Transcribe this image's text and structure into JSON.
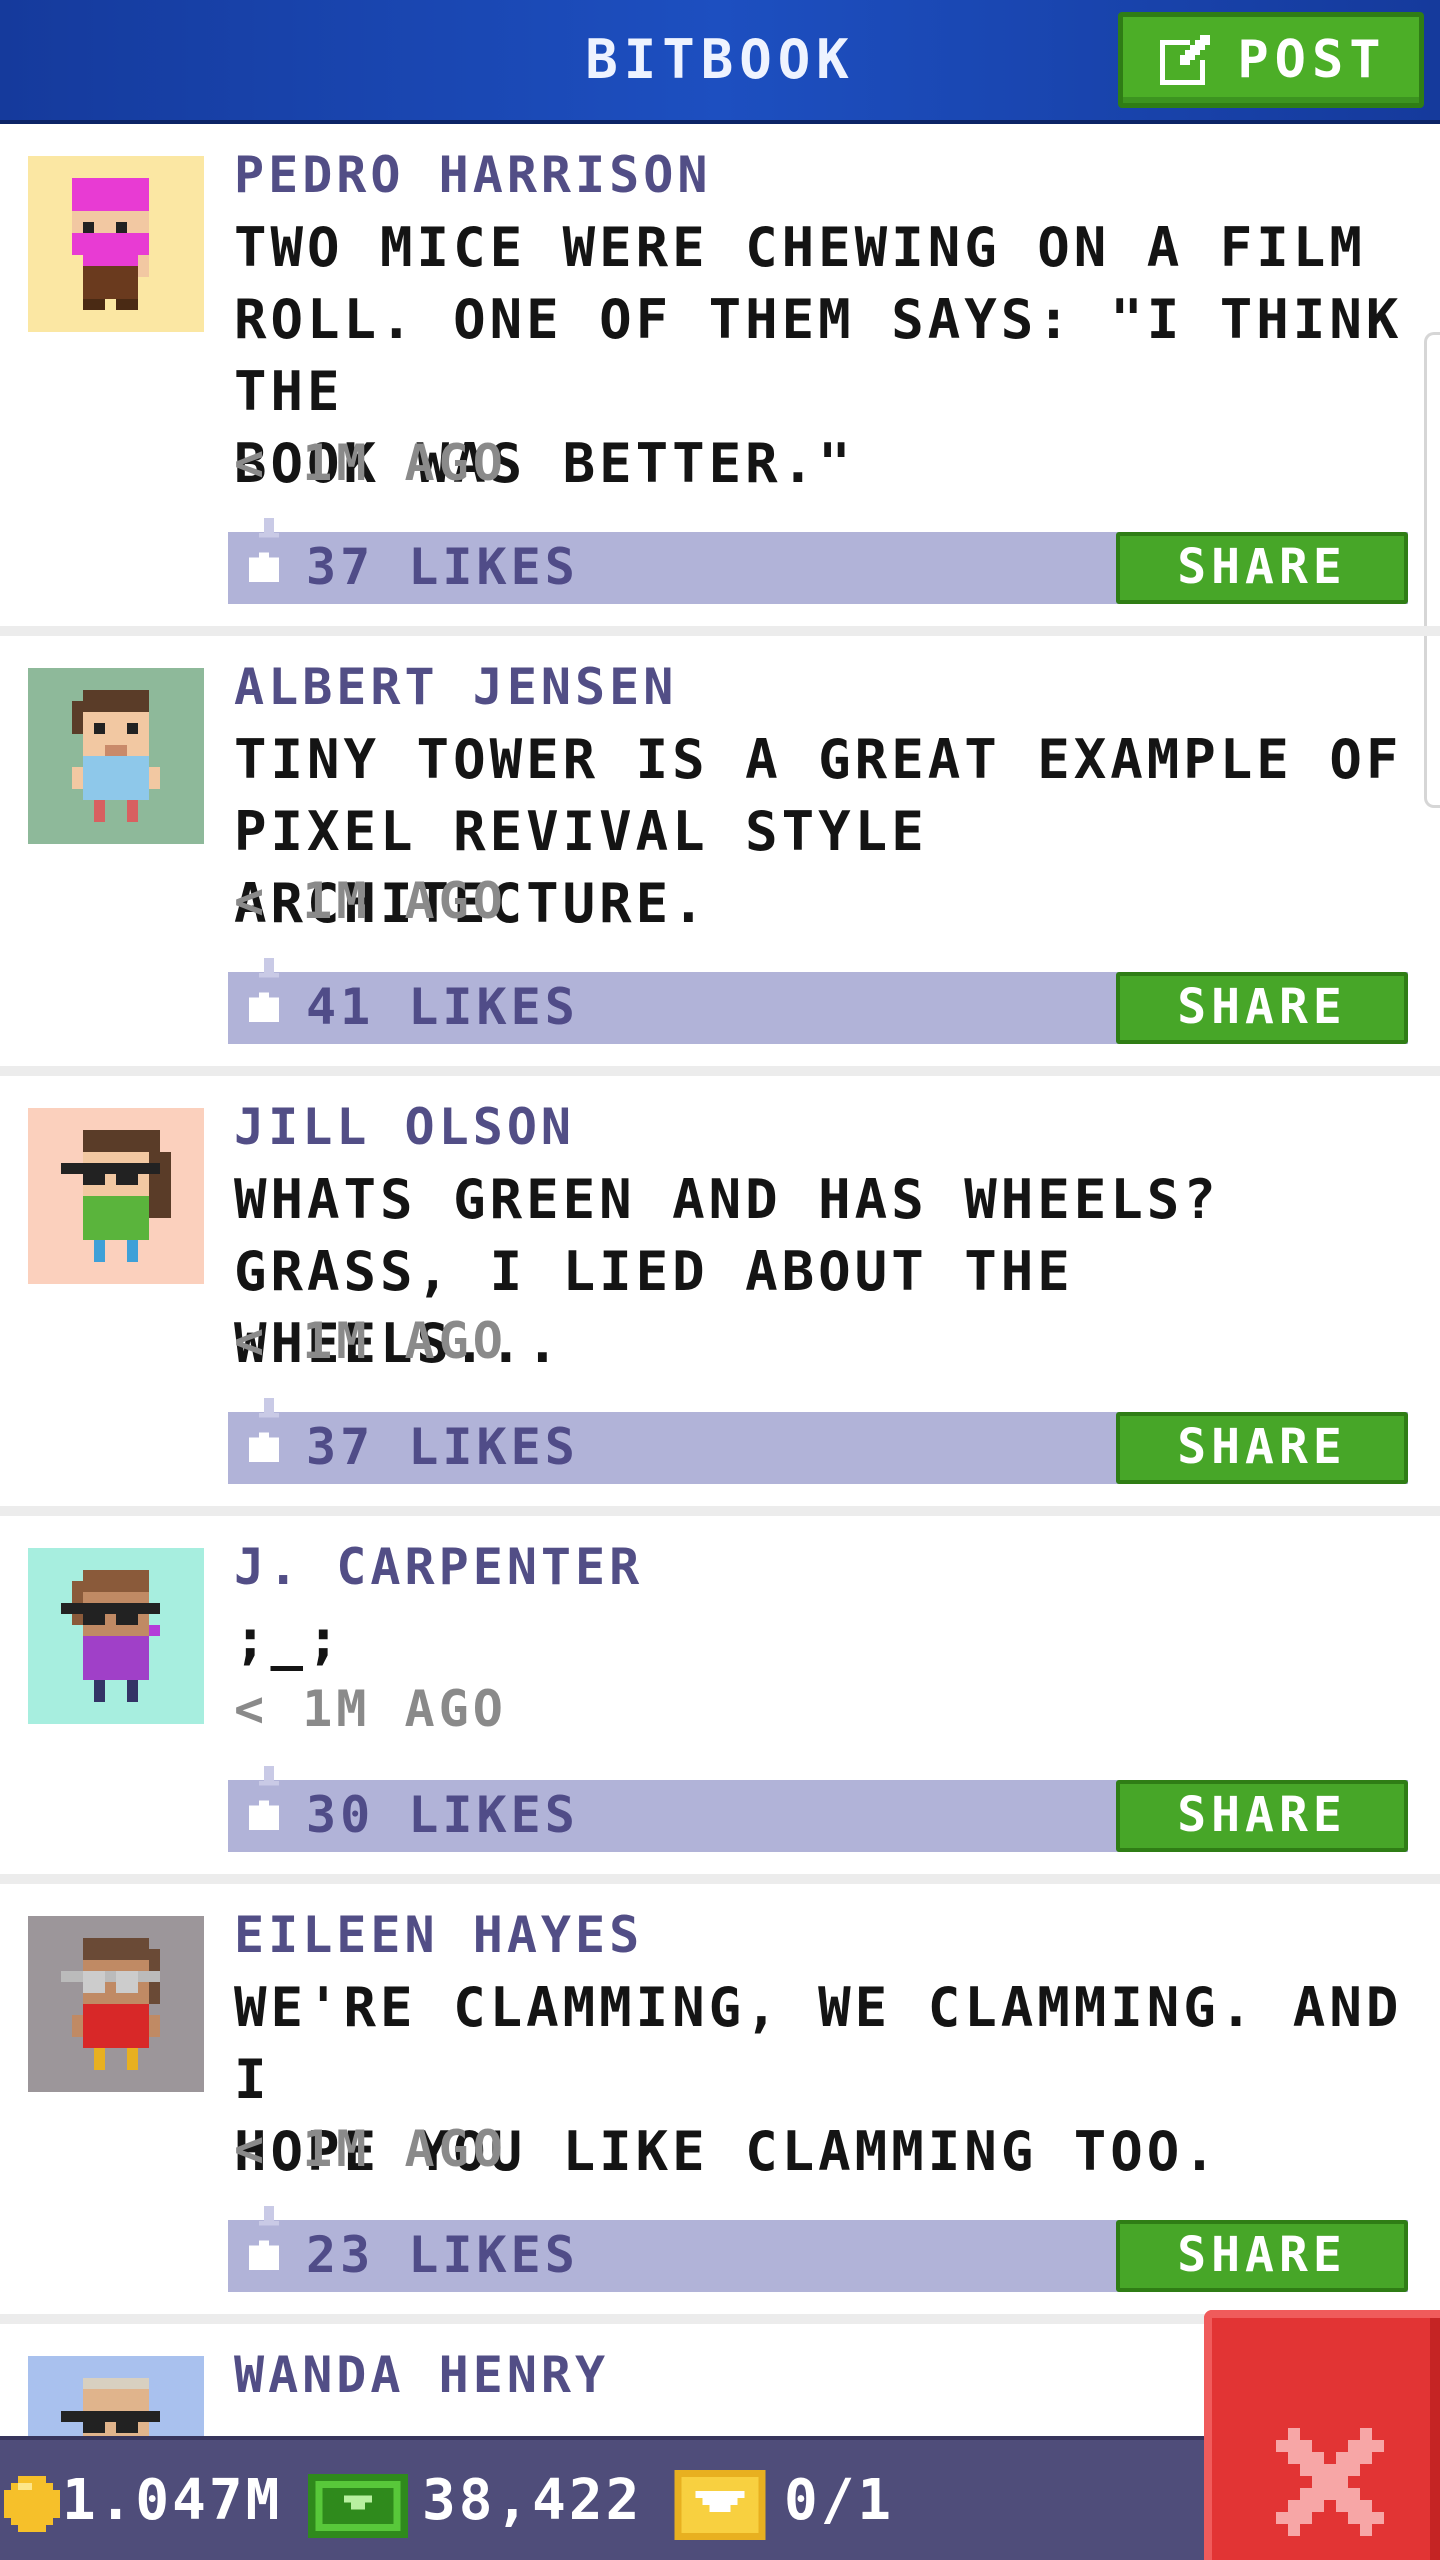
{
  "header": {
    "title": "BITBOOK",
    "post_label": "POST"
  },
  "posts": [
    {
      "author": "PEDRO HARRISON",
      "text": "TWO MICE WERE CHEWING ON A FILM\nROLL. ONE OF THEM SAYS: \"I THINK THE\nBOOK WAS BETTER.\"",
      "time": "< 1M AGO",
      "likes": "37 LIKES",
      "share_label": "SHARE",
      "avatar_bg": "#fbe7a3"
    },
    {
      "author": "ALBERT JENSEN",
      "text": "TINY TOWER IS A GREAT EXAMPLE OF\nPIXEL REVIVAL STYLE ARCHITECTURE.",
      "time": "< 1M AGO",
      "likes": "41 LIKES",
      "share_label": "SHARE",
      "avatar_bg": "#8eb99a"
    },
    {
      "author": "JILL OLSON",
      "text": "WHATS GREEN AND HAS WHEELS?\nGRASS, I LIED ABOUT THE WHEELS...",
      "time": "< 1M AGO",
      "likes": "37 LIKES",
      "share_label": "SHARE",
      "avatar_bg": "#fbd0bd"
    },
    {
      "author": "J. CARPENTER",
      "text": ";_;",
      "time": "< 1M AGO",
      "likes": "30 LIKES",
      "share_label": "SHARE",
      "avatar_bg": "#a7eedf"
    },
    {
      "author": "EILEEN HAYES",
      "text": "WE'RE CLAMMING, WE CLAMMING. AND I\nHOPE YOU LIKE CLAMMING TOO.",
      "time": "< 1M AGO",
      "likes": "23 LIKES",
      "share_label": "SHARE",
      "avatar_bg": "#9c969a"
    },
    {
      "author": "WANDA HENRY",
      "avatar_bg": "#a9c1ee"
    }
  ],
  "stats": {
    "coins": "1.047M",
    "bux": "38,422",
    "tickets": "0/1"
  },
  "colors": {
    "header": "#1d4fc0",
    "accent_green": "#47a628",
    "likes_bar": "#b1b3d8",
    "close_red": "#e23434",
    "bottom_bar": "#4f4d7a"
  }
}
